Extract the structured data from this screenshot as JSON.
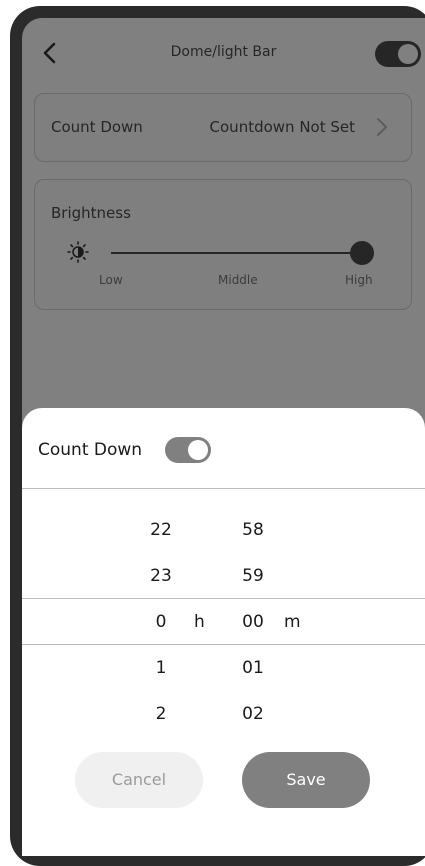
{
  "header": {
    "title": "Dome/light Bar",
    "power_toggle_on": true
  },
  "countdown_card": {
    "label": "Count Down",
    "value": "Countdown Not Set"
  },
  "brightness_card": {
    "label": "Brightness",
    "level": "High",
    "scale": {
      "low": "Low",
      "middle": "Middle",
      "high": "High"
    }
  },
  "sheet": {
    "title": "Count Down",
    "toggle_on": true,
    "picker": {
      "hours": [
        "22",
        "23",
        "0",
        "1",
        "2"
      ],
      "minutes": [
        "58",
        "59",
        "00",
        "01",
        "02"
      ],
      "hour_unit": "h",
      "minute_unit": "m"
    },
    "cancel_label": "Cancel",
    "save_label": "Save"
  },
  "colors": {
    "overlay": "#808080",
    "dark": "#262626",
    "sheet_bg": "#ffffff",
    "save_button": "#808080",
    "cancel_button": "#f0f0f0"
  }
}
